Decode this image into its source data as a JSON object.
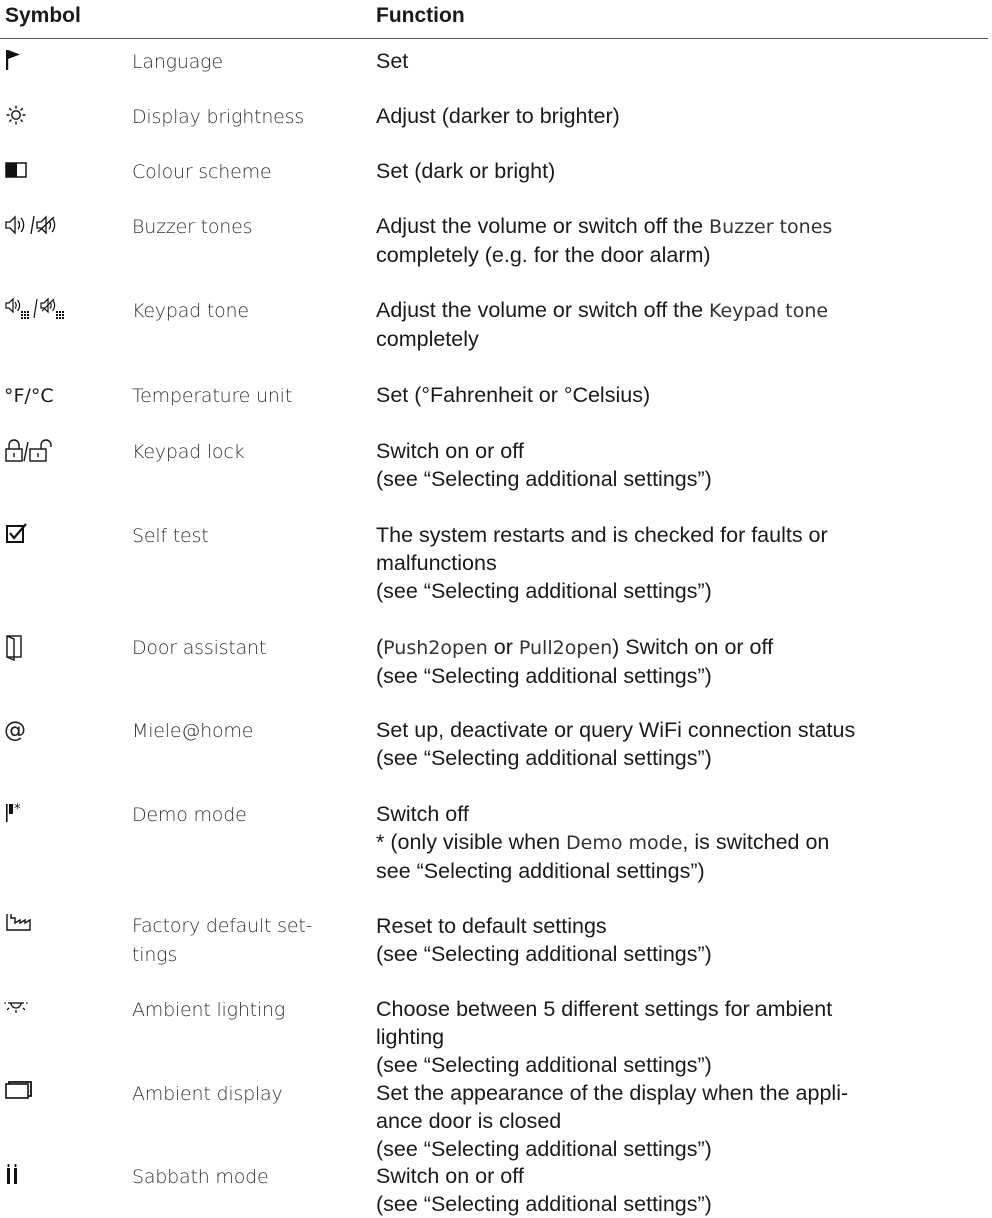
{
  "header": {
    "symbol": "Symbol",
    "function": "Function"
  },
  "rows": [
    {
      "icon": "flag-icon",
      "setting": "Language",
      "function": [
        "Set"
      ]
    },
    {
      "icon": "sun-icon",
      "setting": "Display brightness",
      "function": [
        "Adjust (darker to brighter)"
      ]
    },
    {
      "icon": "colour-scheme-icon",
      "setting": "Colour scheme",
      "function": [
        "Set (dark or bright)"
      ]
    },
    {
      "icon": "speaker-icon",
      "setting": "Buzzer tones",
      "function": [
        "Adjust the volume or switch off the",
        "Buzzer tones",
        "completely (e.g. for the door alarm)"
      ]
    },
    {
      "icon": "keypad-speaker-icon",
      "setting": "Keypad tone",
      "function": [
        "Adjust the volume or switch off the",
        "Keypad tone",
        "completely"
      ]
    },
    {
      "icon": "temperature-unit-icon",
      "symbol_text": "°F/°C",
      "setting": "Temperature unit",
      "function": [
        "Set (°Fahrenheit or °Celsius)"
      ]
    },
    {
      "icon": "padlock-icon",
      "setting": "Keypad lock",
      "function": [
        "Switch on or off",
        "(see “Selecting additional settings”)"
      ]
    },
    {
      "icon": "checkbox-icon",
      "setting": "Self test",
      "function": [
        "The system restarts and is checked for faults or",
        "malfunctions",
        "(see “Selecting additional settings”)"
      ]
    },
    {
      "icon": "door-icon",
      "setting": "Door assistant",
      "function": [
        "(",
        "Push2open",
        "or",
        "Pull2open",
        ") Switch on or off",
        "(see “Selecting additional settings”)"
      ]
    },
    {
      "icon": "at-icon",
      "symbol_text": "@",
      "setting": "Miele@home",
      "function": [
        "Set up, deactivate or query WiFi connection status",
        "(see “Selecting additional settings”)"
      ]
    },
    {
      "icon": "demo-flag-icon",
      "setting": "Demo mode",
      "function": [
        "Switch off",
        "* (only visible when",
        "Demo mode",
        ", is switched on",
        "see “Selecting additional settings”)"
      ]
    },
    {
      "icon": "factory-icon",
      "setting": "Factory default set-\ntings",
      "function": [
        "Reset to default settings",
        "(see “Selecting additional settings”)"
      ]
    },
    {
      "icon": "ambient-light-icon",
      "setting": "Ambient lighting",
      "function": [
        "Choose between 5 different settings for ambient",
        "lighting",
        "(see “Selecting additional settings”)"
      ]
    },
    {
      "icon": "ambient-display-icon",
      "setting": "Ambient display",
      "function": [
        "Set the appearance of the display when the appli-",
        "ance door is closed",
        "(see “Selecting additional settings”)"
      ]
    },
    {
      "icon": "sabbath-icon",
      "setting": "Sabbath mode",
      "function": [
        "Switch on or off",
        "(see “Selecting additional settings”)"
      ]
    }
  ]
}
